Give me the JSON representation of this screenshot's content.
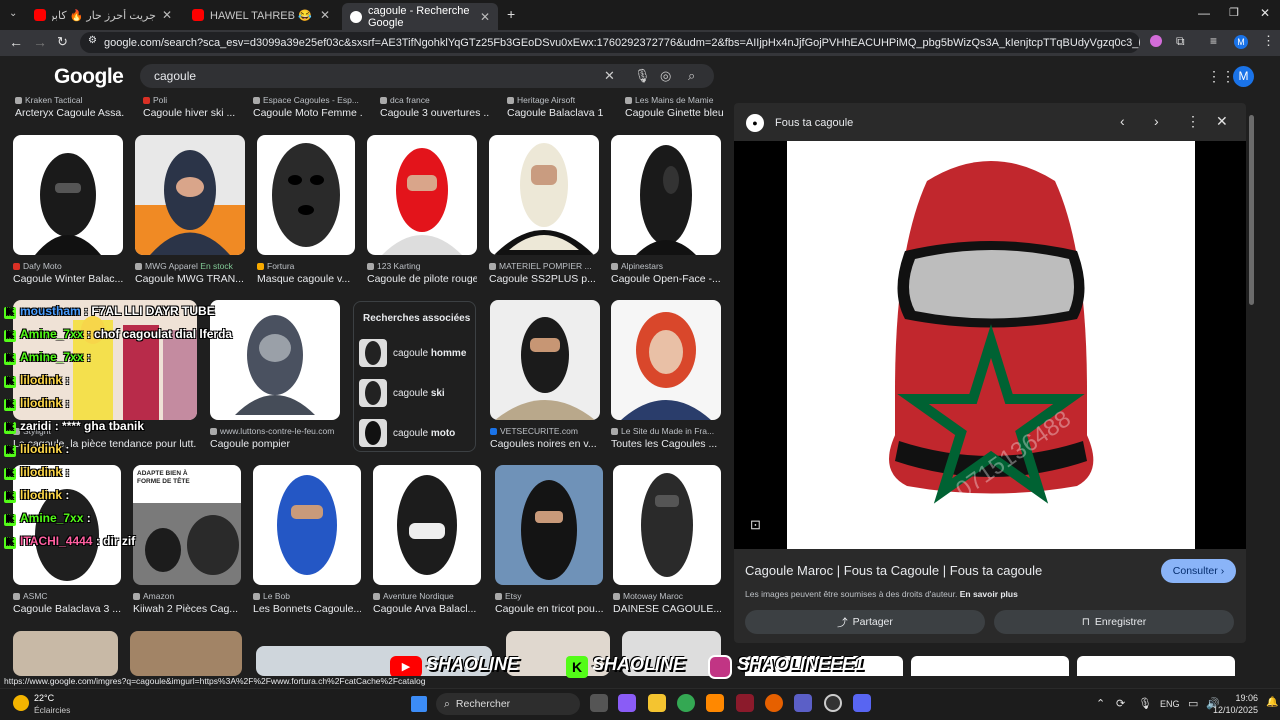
{
  "browser": {
    "tabs": [
      {
        "label": "جريت أحرز حار 🔥 كابن فالمغرب",
        "active": false
      },
      {
        "label": "HAWEL TAHREB 😂 48 ساعة فـ",
        "active": false
      },
      {
        "label": "cagoule - Recherche Google",
        "active": true
      }
    ],
    "new_tab": "+",
    "url": "google.com/search?sca_esv=d3099a39e25ef03c&sxsrf=AE3TifNgohklYqGTz25Fb3GEoDSvu0xEwx:1760292372776&udm=2&fbs=AIIjpHx4nJjfGojPVHhEACUHPiMQ_pbg5bWizQs3A_kIenjtcpTTqBUdyVgzq0c3_k8z34EAuM72an33IMW6RWde9eP..."
  },
  "google": {
    "logo": "Google",
    "query": "cagoule",
    "account_initial": "M"
  },
  "row0": [
    {
      "source": "Kraken Tactical",
      "title": "Arcteryx Cagoule Assa..."
    },
    {
      "source": "Poli",
      "title": "Cagoule hiver ski ..."
    },
    {
      "source": "Espace Cagoules - Esp...",
      "title": "Cagoule Moto Femme ..."
    },
    {
      "source": "dca france",
      "title": "Cagoule 3 ouvertures ..."
    },
    {
      "source": "Heritage Airsoft",
      "title": "Cagoule Balaclava 1 ..."
    },
    {
      "source": "Les Mains de Mamie",
      "title": "Cagoule Ginette bleu"
    }
  ],
  "row1": [
    {
      "source": "Dafy Moto",
      "stock": "",
      "title": "Cagoule Winter Balac..."
    },
    {
      "source": "MWG Apparel",
      "stock": "En stock",
      "title": "Cagoule MWG TRAN..."
    },
    {
      "source": "Fortura",
      "stock": "",
      "title": "Masque cagoule v..."
    },
    {
      "source": "123 Karting",
      "stock": "",
      "title": "Cagoule de pilote rouge"
    },
    {
      "source": "MATERIEL POMPIER ...",
      "stock": "",
      "title": "Cagoule SS2PLUS p..."
    },
    {
      "source": "Alpinestars",
      "stock": "",
      "title": "Cagoule Open-Face -..."
    }
  ],
  "row2": [
    {
      "source": "Stylight",
      "title": "La cagoule, la pièce tendance pour lutt..."
    },
    {
      "source": "www.luttons-contre-le-feu.com",
      "title": "Cagoule pompier"
    },
    {
      "source": "VETSECURITE.com",
      "title": "Cagoules noires en v..."
    },
    {
      "source": "Le Site du Made in Fra...",
      "title": "Toutes les Cagoules ..."
    }
  ],
  "related": {
    "heading": "Recherches associées",
    "items": [
      {
        "prefix": "cagoule",
        "bold": "homme"
      },
      {
        "prefix": "cagoule",
        "bold": "ski"
      },
      {
        "prefix": "cagoule",
        "bold": "moto"
      }
    ]
  },
  "row3": [
    {
      "source": "ASMC",
      "title": "Cagoule Balaclava 3 ..."
    },
    {
      "source": "Amazon",
      "title": "Kiiwah 2 Pièces Cag..."
    },
    {
      "source": "Le Bob",
      "title": "Les Bonnets Cagoule..."
    },
    {
      "source": "Aventure Nordique",
      "title": "Cagoule Arva Balacl..."
    },
    {
      "source": "Etsy",
      "title": "Cagoule en tricot pou..."
    },
    {
      "source": "Motoway Maroc",
      "title": "DAINESE CAGOULE..."
    }
  ],
  "ad_text": [
    "ADAPTE BIEN À",
    "FORME DE TÊTE"
  ],
  "panel": {
    "source": "Fous ta cagoule",
    "watermark": "0715136488",
    "title": "Cagoule Maroc | Fous ta Cagoule | Fous ta cagoule",
    "visit_button": "Consulter",
    "rights_text": "Les images peuvent être soumises à des droits d'auteur.",
    "rights_link": "En savoir plus",
    "share_button": "Partager",
    "save_button": "Enregistrer"
  },
  "chat": [
    {
      "user": "moustham",
      "msg": ": F7AL LLI DAYR TUBE",
      "ucolor": "#4a9eff"
    },
    {
      "user": "Amine_7xx",
      "msg": ": chof cagoulat dial lferda",
      "ucolor": "#53fc18"
    },
    {
      "user": "Amine_7xx",
      "msg": ":",
      "ucolor": "#53fc18"
    },
    {
      "user": "lilodink",
      "msg": ":",
      "ucolor": "#ffd84a"
    },
    {
      "user": "lilodink",
      "msg": ":",
      "ucolor": "#ffd84a"
    },
    {
      "user": "zaridi",
      "msg": ": **** gha tbanik",
      "ucolor": "#ffffff"
    },
    {
      "user": "lilodink",
      "msg": ":",
      "ucolor": "#ffd84a"
    },
    {
      "user": "lilodink",
      "msg": ":",
      "ucolor": "#ffd84a"
    },
    {
      "user": "lilodink",
      "msg": ":",
      "ucolor": "#ffd84a"
    },
    {
      "user": "Amine_7xx",
      "msg": ":",
      "ucolor": "#53fc18"
    },
    {
      "user": "ITACHI_4444",
      "msg": ": dir zif",
      "ucolor": "#ff5fa0"
    }
  ],
  "stream_banner": [
    "SHAOLINE",
    "SHAOLINE",
    "SHAOLINEEE1"
  ],
  "status_url": "https://www.google.com/imgres?q=cagoule&imgurl=https%3A%2F%2Fwww.fortura.ch%2FcatCache%2Fcatalog",
  "taskbar": {
    "temp": "22°C",
    "weather": "Éclaircies",
    "search_placeholder": "Rechercher",
    "lang": "ENG",
    "time": "19:06",
    "date": "12/10/2025"
  },
  "colors": {
    "accent": "#8ab4f8",
    "consult_bg": "#8ab4f8",
    "maroc_red": "#c1272d",
    "maroc_green": "#006233"
  }
}
